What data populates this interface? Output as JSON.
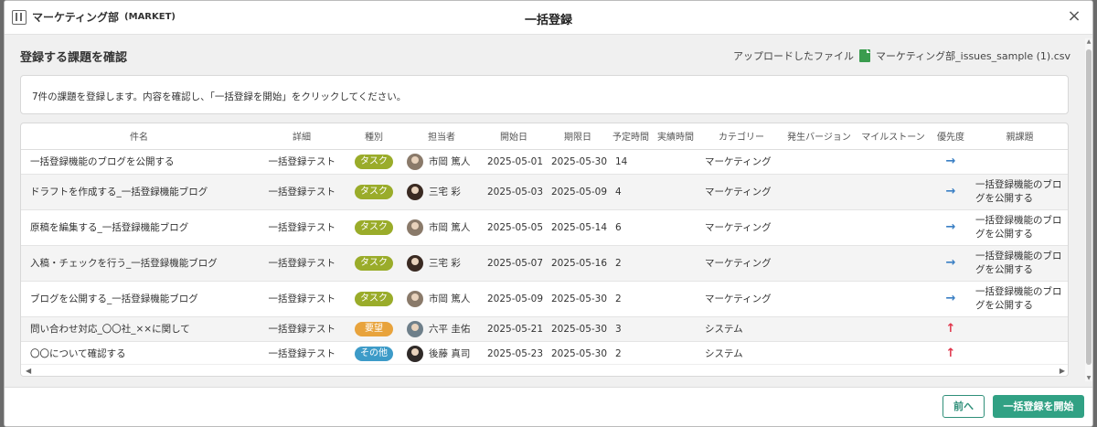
{
  "header": {
    "project_name": "マーケティング部",
    "project_key": "(MARKET)",
    "dialog_title": "一括登録",
    "close_symbol": "×"
  },
  "section": {
    "title": "登録する課題を確認",
    "uploaded_label": "アップロードしたファイル",
    "file_name": "マーケティング部_issues_sample (1).csv"
  },
  "notice": "7件の課題を登録します。内容を確認し、「一括登録を開始」をクリックしてください。",
  "table": {
    "columns": [
      "件名",
      "詳細",
      "種別",
      "担当者",
      "開始日",
      "期限日",
      "予定時間",
      "実績時間",
      "カテゴリー",
      "発生バージョン",
      "マイルストーン",
      "優先度",
      "親課題"
    ],
    "rows": [
      {
        "name": "一括登録機能のブログを公開する",
        "detail": "一括登録テスト",
        "type": "タスク",
        "type_color": "#9aac2a",
        "assignee": "市岡 篤人",
        "avatar": "m",
        "start": "2025-05-01",
        "due": "2025-05-30",
        "estimate": "14",
        "actual": "",
        "category": "マーケティング",
        "version": "",
        "milestone": "",
        "priority": "normal",
        "priority_icon": "→",
        "parent": ""
      },
      {
        "name": "ドラフトを作成する_一括登録機能ブログ",
        "detail": "一括登録テスト",
        "type": "タスク",
        "type_color": "#9aac2a",
        "assignee": "三宅 彩",
        "avatar": "f",
        "start": "2025-05-03",
        "due": "2025-05-09",
        "estimate": "4",
        "actual": "",
        "category": "マーケティング",
        "version": "",
        "milestone": "",
        "priority": "normal",
        "priority_icon": "→",
        "parent": "一括登録機能のブログを公開する"
      },
      {
        "name": "原稿を編集する_一括登録機能ブログ",
        "detail": "一括登録テスト",
        "type": "タスク",
        "type_color": "#9aac2a",
        "assignee": "市岡 篤人",
        "avatar": "m",
        "start": "2025-05-05",
        "due": "2025-05-14",
        "estimate": "6",
        "actual": "",
        "category": "マーケティング",
        "version": "",
        "milestone": "",
        "priority": "normal",
        "priority_icon": "→",
        "parent": "一括登録機能のブログを公開する"
      },
      {
        "name": "入稿・チェックを行う_一括登録機能ブログ",
        "detail": "一括登録テスト",
        "type": "タスク",
        "type_color": "#9aac2a",
        "assignee": "三宅 彩",
        "avatar": "f",
        "start": "2025-05-07",
        "due": "2025-05-16",
        "estimate": "2",
        "actual": "",
        "category": "マーケティング",
        "version": "",
        "milestone": "",
        "priority": "normal",
        "priority_icon": "→",
        "parent": "一括登録機能のブログを公開する"
      },
      {
        "name": "ブログを公開する_一括登録機能ブログ",
        "detail": "一括登録テスト",
        "type": "タスク",
        "type_color": "#9aac2a",
        "assignee": "市岡 篤人",
        "avatar": "m",
        "start": "2025-05-09",
        "due": "2025-05-30",
        "estimate": "2",
        "actual": "",
        "category": "マーケティング",
        "version": "",
        "milestone": "",
        "priority": "normal",
        "priority_icon": "→",
        "parent": "一括登録機能のブログを公開する"
      },
      {
        "name": "問い合わせ対応_〇〇社_××に関して",
        "detail": "一括登録テスト",
        "type": "要望",
        "type_color": "#e8a33c",
        "assignee": "六平 圭佑",
        "avatar": "m2",
        "start": "2025-05-21",
        "due": "2025-05-30",
        "estimate": "3",
        "actual": "",
        "category": "システム",
        "version": "",
        "milestone": "",
        "priority": "high",
        "priority_icon": "↑",
        "parent": ""
      },
      {
        "name": "〇〇について確認する",
        "detail": "一括登録テスト",
        "type": "その他",
        "type_color": "#3d9bc8",
        "assignee": "後藤 真司",
        "avatar": "m3",
        "start": "2025-05-23",
        "due": "2025-05-30",
        "estimate": "2",
        "actual": "",
        "category": "システム",
        "version": "",
        "milestone": "",
        "priority": "high",
        "priority_icon": "↑",
        "parent": ""
      }
    ]
  },
  "colors": {
    "accent": "#31a184",
    "priority_normal": "#3a7fc4",
    "priority_high": "#e0344a"
  },
  "footer": {
    "back_label": "前へ",
    "start_label": "一括登録を開始"
  },
  "scroll": {
    "left": "◀",
    "right": "▶",
    "up": "▲",
    "down": "▼"
  }
}
